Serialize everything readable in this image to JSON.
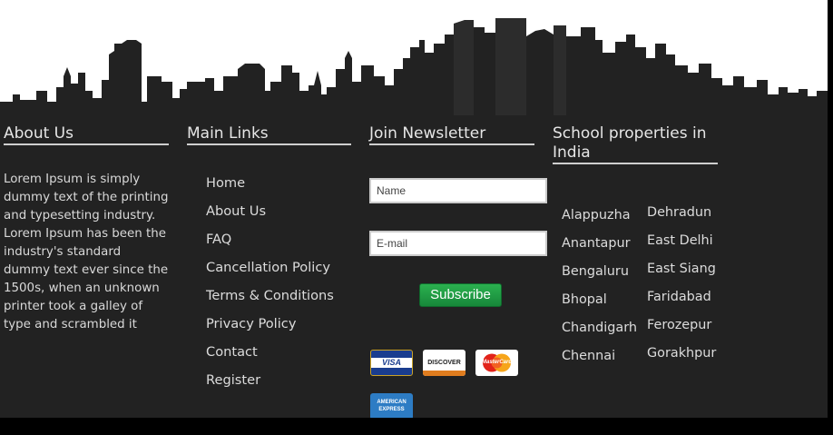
{
  "about": {
    "title": "About Us",
    "text": "Lorem Ipsum is simply dummy text of the printing and typesetting industry. Lorem Ipsum has been the industry's standard dummy text ever since the 1500s, when an unknown printer took a galley of type and scrambled it"
  },
  "main_links": {
    "title": "Main Links",
    "items": [
      "Home",
      "About Us",
      "FAQ",
      "Cancellation Policy",
      "Terms & Conditions",
      "Privacy Policy",
      "Contact",
      "Register"
    ]
  },
  "newsletter": {
    "title": "Join Newsletter",
    "name_placeholder": "Name",
    "email_placeholder": "E-mail",
    "subscribe_label": "Subscribe",
    "cards": [
      "VISA",
      "DISCOVER",
      "MasterCard",
      "AMERICAN EXPRESS"
    ]
  },
  "schools": {
    "title": "School properties in India",
    "col1": [
      "Alappuzha",
      "Anantapur",
      "Bengaluru",
      "Bhopal",
      "Chandigarh",
      "Chennai"
    ],
    "col2": [
      "Dehradun",
      "East Delhi",
      "East Siang",
      "Faridabad",
      "Ferozepur",
      "Gorakhpur"
    ]
  },
  "colors": {
    "footer_bg": "#222222",
    "subscribe_green": "#1f9e45",
    "text": "#dddddd"
  }
}
